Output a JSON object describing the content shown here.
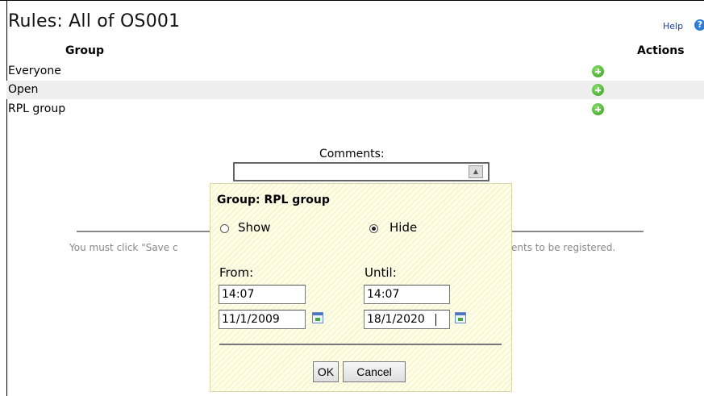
{
  "page": {
    "title": "Rules: All of OS001",
    "help": {
      "label": "Help"
    }
  },
  "table": {
    "headers": {
      "group": "Group",
      "actions": "Actions"
    },
    "rows": [
      {
        "group": "Everyone",
        "action_icon": "add-icon"
      },
      {
        "group": "Open",
        "action_icon": "add-icon"
      },
      {
        "group": "RPL group",
        "action_icon": "add-icon"
      }
    ]
  },
  "comments": {
    "label": "Comments:",
    "value": ""
  },
  "notice": {
    "left": "You must click \"Save c",
    "right": "ents to be registered."
  },
  "dialog": {
    "title": "Group: RPL group",
    "visibility": {
      "show_label": "Show",
      "hide_label": "Hide",
      "selected": "Hide"
    },
    "from": {
      "label": "From:",
      "time": "14:07",
      "date": "11/1/2009"
    },
    "until": {
      "label": "Until:",
      "time": "14:07",
      "date": "18/1/2020"
    },
    "buttons": {
      "ok": "OK",
      "cancel": "Cancel"
    }
  },
  "colors": {
    "add_icon": "#3aa823",
    "help_link": "#1a3ea8",
    "dialog_background": "#fbfbdc",
    "row_stripe": "#eeeeee"
  }
}
